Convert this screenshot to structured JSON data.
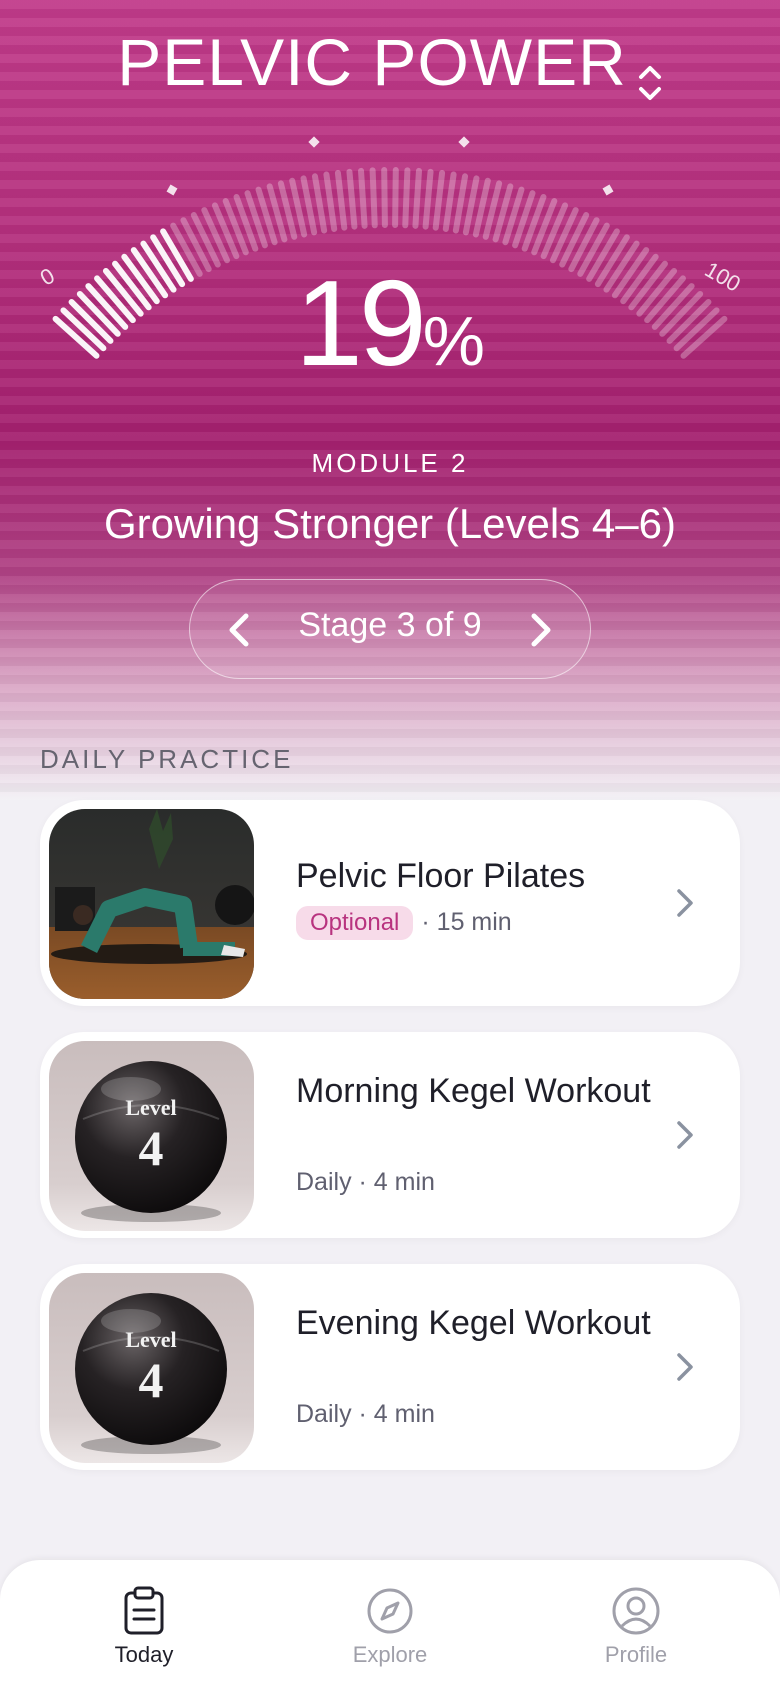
{
  "header": {
    "app_title": "PELVIC POWER",
    "switcher_icon": "chevron-updown-icon"
  },
  "progress": {
    "value": 19,
    "percent_sign": "%",
    "min_label": "0",
    "max_label": "100",
    "fraction": 0.19
  },
  "module": {
    "label": "MODULE 2",
    "title": "Growing Stronger (Levels 4–6)"
  },
  "stage": {
    "label": "Stage 3 of 9",
    "prev_icon": "chevron-left-icon",
    "next_icon": "chevron-right-icon"
  },
  "daily_practice": {
    "section_label": "DAILY PRACTICE",
    "items": [
      {
        "title": "Pelvic Floor Pilates",
        "badge": "Optional",
        "meta": "· 15 min",
        "thumbnail": "pilates-photo"
      },
      {
        "title": "Morning Kegel Workout",
        "meta": "Daily · 4 min",
        "thumbnail": "level-ball",
        "ball_text_top": "Level",
        "ball_text_num": "4"
      },
      {
        "title": "Evening Kegel Workout",
        "meta": "Daily · 4 min",
        "thumbnail": "level-ball",
        "ball_text_top": "Level",
        "ball_text_num": "4"
      }
    ]
  },
  "tabbar": {
    "tabs": [
      {
        "label": "Today",
        "icon": "clipboard-icon",
        "active": true
      },
      {
        "label": "Explore",
        "icon": "compass-icon",
        "active": false
      },
      {
        "label": "Profile",
        "icon": "person-icon",
        "active": false
      }
    ]
  },
  "colors": {
    "brand": "#b42f7d",
    "badge_bg": "#f7dbe9",
    "badge_text": "#b8337f"
  }
}
